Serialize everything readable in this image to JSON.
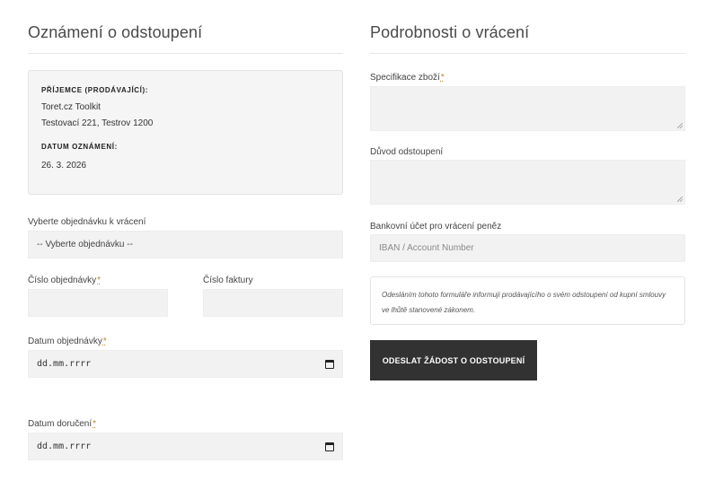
{
  "left": {
    "title": "Oznámení o odstoupení",
    "recipient_heading": "PŘÍJEMCE (PRODÁVAJÍCÍ):",
    "recipient_name": "Toret.cz Toolkit",
    "recipient_address": "Testovací 221, Testrov 1200",
    "date_heading": "DATUM OZNÁMENÍ:",
    "date_value": "26. 3. 2026",
    "order_select_label": "Vyberte objednávku k vrácení",
    "order_select_value": "-- Vyberte objednávku --",
    "order_number_label": "Číslo objednávky",
    "invoice_number_label": "Číslo faktury",
    "order_date_label": "Datum objednávky",
    "order_date_value": "dd.mm.rrrr",
    "delivery_date_label": "Datum doručení",
    "delivery_date_value": "dd.mm.rrrr",
    "required_mark": "*"
  },
  "right": {
    "title": "Podrobnosti o vrácení",
    "goods_spec_label": "Specifikace zboží",
    "reason_label": "Důvod odstoupení",
    "bank_label": "Bankovní účet pro vrácení peněz",
    "bank_placeholder": "IBAN / Account Number",
    "notice_text": "Odesláním tohoto formuláře informuji prodávajícího o svém odstoupení od kupní smlouvy ve lhůtě stanovené zákonem.",
    "submit_label": "ODESLAT ŽÁDOST O ODSTOUPENÍ"
  },
  "icons": {
    "calendar": "calendar-icon",
    "resize": "resize-handle-icon"
  },
  "colors": {
    "button_bg": "#323232",
    "field_bg": "#f2f2f2",
    "required": "#b58a2a"
  }
}
